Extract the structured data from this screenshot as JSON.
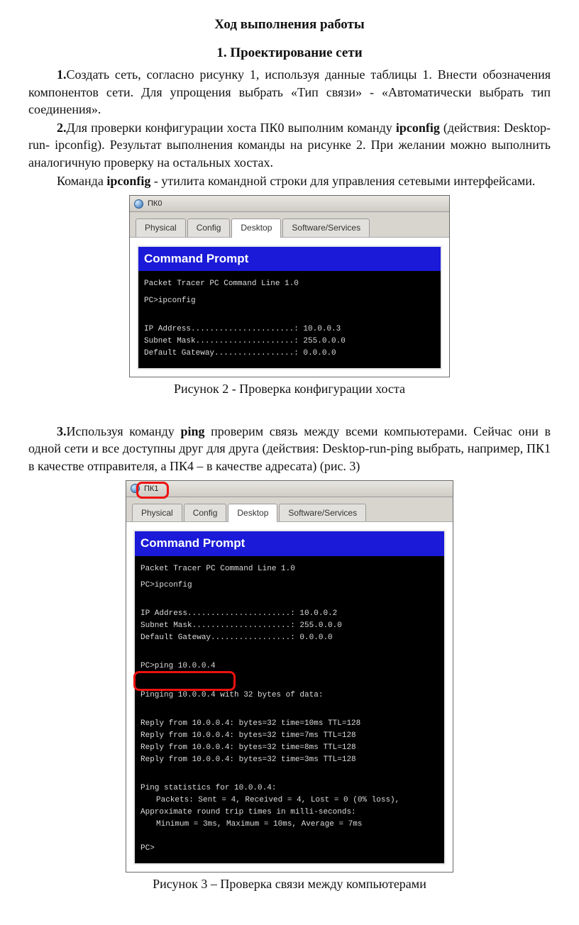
{
  "title": "Ход выполнения работы",
  "section": {
    "num": "1.",
    "title": "Проектирование сети"
  },
  "p1": {
    "num": "1.",
    "text": "Создать сеть, согласно рисунку 1, используя данные таблицы 1. Внести обозначения компонентов сети. Для упрощения выбрать «Тип связи» - «Автоматически выбрать тип соединения»."
  },
  "p2": {
    "num": "2.",
    "text_a": "Для проверки конфигурации хоста ПК0 выполним команду ",
    "cmd": "ipconfig",
    "text_b": " (действия: Desktop-run- ipconfig). Результат выполнения команды на рисунке 2. При желании можно выполнить аналогичную проверку на остальных хостах."
  },
  "p2b": {
    "pre": "Команда ",
    "cmd": "ipconfig",
    "post": " - утилита командной строки для управления сетевыми интерфейсами."
  },
  "fig2": {
    "caption": "Рисунок 2 - Проверка конфигурации хоста"
  },
  "p3": {
    "num": "3.",
    "text_a": "Используя команду ",
    "cmd": "ping",
    "text_b": " проверим связь между всеми компьютерами. Сейчас они в одной сети и все доступны друг для друга (действия: Desktop-run-ping выбрать, например, ПК1 в качестве отправителя, а ПК4 – в качестве адресата) (рис. 3)"
  },
  "fig3": {
    "caption": "Рисунок 3 – Проверка связи между компьютерами"
  },
  "win1": {
    "title": "ПК0",
    "tabs": [
      "Physical",
      "Config",
      "Desktop",
      "Software/Services"
    ],
    "active_tab": "Desktop",
    "cmd_title": "Command Prompt",
    "lines": {
      "l1": "Packet Tracer PC Command Line 1.0",
      "l2": "PC>ipconfig",
      "ip": "IP Address......................: 10.0.0.3",
      "mask": "Subnet Mask.....................: 255.0.0.0",
      "gw": "Default Gateway.................: 0.0.0.0"
    }
  },
  "win2": {
    "title": "ПК1",
    "tabs": [
      "Physical",
      "Config",
      "Desktop",
      "Software/Services"
    ],
    "active_tab": "Desktop",
    "cmd_title": "Command Prompt",
    "lines": {
      "l1": "Packet Tracer PC Command Line 1.0",
      "l2": "PC>ipconfig",
      "ip": "IP Address......................: 10.0.0.2",
      "mask": "Subnet Mask.....................: 255.0.0.0",
      "gw": "Default Gateway.................: 0.0.0.0",
      "ping": "PC>ping 10.0.0.4",
      "pinging": "Pinging 10.0.0.4 with 32 bytes of data:",
      "r1": "Reply from 10.0.0.4: bytes=32 time=10ms TTL=128",
      "r2": "Reply from 10.0.0.4: bytes=32 time=7ms TTL=128",
      "r3": "Reply from 10.0.0.4: bytes=32 time=8ms TTL=128",
      "r4": "Reply from 10.0.0.4: bytes=32 time=3ms TTL=128",
      "stats": "Ping statistics for 10.0.0.4:",
      "pkt": "Packets: Sent = 4, Received = 4, Lost = 0 (0% loss),",
      "approx": "Approximate round trip times in milli-seconds:",
      "minmax": "Minimum = 3ms, Maximum = 10ms, Average = 7ms",
      "prompt": "PC>"
    }
  }
}
